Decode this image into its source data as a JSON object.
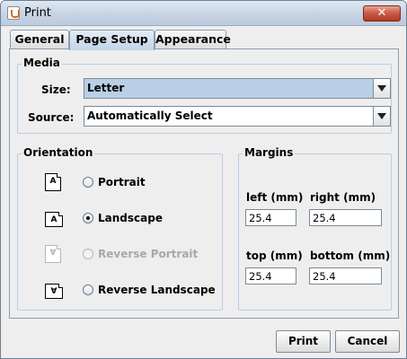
{
  "window": {
    "title": "Print",
    "close_glyph": "✕"
  },
  "tabs": [
    {
      "label": "General",
      "active": false
    },
    {
      "label": "Page Setup",
      "active": true
    },
    {
      "label": "Appearance",
      "active": false
    }
  ],
  "media": {
    "group_title": "Media",
    "size_label": "Size:",
    "size_value": "Letter",
    "source_label": "Source:",
    "source_value": "Automatically Select"
  },
  "orientation": {
    "group_title": "Orientation",
    "options": [
      {
        "label": "Portrait",
        "icon": "portrait-page-icon",
        "glyph": "A",
        "checked": false,
        "enabled": true
      },
      {
        "label": "Landscape",
        "icon": "landscape-page-icon",
        "glyph": "A",
        "checked": true,
        "enabled": true
      },
      {
        "label": "Reverse Portrait",
        "icon": "reverse-portrait-page-icon",
        "glyph": "∀",
        "checked": false,
        "enabled": false
      },
      {
        "label": "Reverse Landscape",
        "icon": "reverse-landscape-page-icon",
        "glyph": "∀",
        "checked": false,
        "enabled": true
      }
    ]
  },
  "margins": {
    "group_title": "Margins",
    "left_label": "left (mm)",
    "right_label": "right (mm)",
    "top_label": "top (mm)",
    "bottom_label": "bottom (mm)",
    "left_value": "25.4",
    "right_value": "25.4",
    "top_value": "25.4",
    "bottom_value": "25.4"
  },
  "buttons": {
    "print": "Print",
    "cancel": "Cancel"
  },
  "colors": {
    "accent": "#b8cfe5",
    "title_close": "#c75a45"
  }
}
